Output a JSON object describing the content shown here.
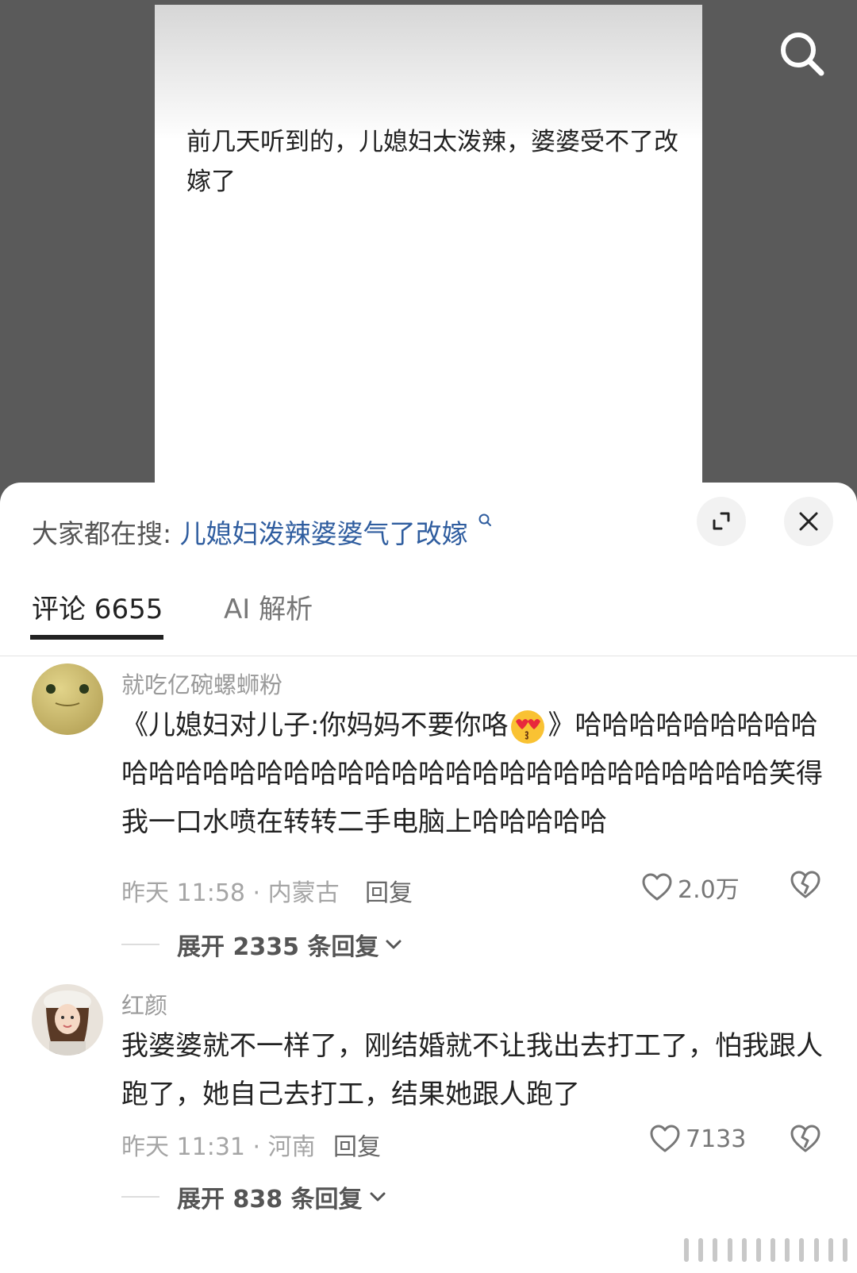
{
  "post": {
    "text": "前几天听到的，儿媳妇太泼辣，婆婆受不了改嫁了",
    "search_icon": "search-icon"
  },
  "sheet": {
    "hot_search_label": "大家都在搜:",
    "hot_search_query": "儿媳妇泼辣婆婆气了改嫁",
    "expand_icon": "expand-icon",
    "close_icon": "close-icon",
    "tabs": [
      {
        "label": "评论 6655",
        "active": true
      },
      {
        "label": "AI 解析",
        "active": false
      }
    ]
  },
  "comments": [
    {
      "username": "就吃亿碗螺蛳粉",
      "avatar": "frog-avatar",
      "text_before_emoji": "《儿媳妇对儿子:你妈妈不要你咯",
      "emoji": "heart-eyes-kiss-emoji",
      "text_after_emoji": "》哈哈哈哈哈哈哈哈哈哈哈哈哈哈哈哈哈哈哈哈哈哈哈哈哈哈哈哈哈哈哈哈哈笑得我一口水喷在转转二手电脑上哈哈哈哈哈",
      "meta": "昨天 11:58 · 内蒙古",
      "reply_label": "回复",
      "likes": "2.0万",
      "expand_label": "展开 2335 条回复"
    },
    {
      "username": "红颜",
      "avatar": "girl-avatar",
      "text": "我婆婆就不一样了，刚结婚就不让我出去打工了，怕我跟人跑了，她自己去打工，结果她跟人跑了",
      "meta": "昨天 11:31 · 河南",
      "reply_label": "回复",
      "likes": "7133",
      "expand_label": "展开 838 条回复"
    }
  ],
  "colors": {
    "accent_link": "#2f5d9f",
    "background_dim": "#5a5a5a",
    "text_primary": "#222222",
    "text_secondary": "#a5a5a5"
  }
}
